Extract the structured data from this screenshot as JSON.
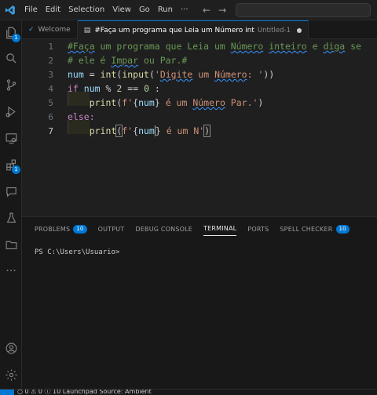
{
  "menu": [
    "File",
    "Edit",
    "Selection",
    "View",
    "Go",
    "Run",
    "···"
  ],
  "tabs": [
    {
      "label": "Welcome"
    },
    {
      "label": "#Faça um programa que Leia um Número int",
      "desc": "Untitled-1"
    }
  ],
  "editor": {
    "line_numbers": [
      "1",
      "2",
      "3",
      "4",
      "5",
      "6",
      "7"
    ],
    "lines": [
      "#Faça um programa que Leia um Número inteiro e diga se",
      "# ele é Impar ou Par.#",
      "num = int(input('Digite um Número: '))",
      "if num % 2 == 0 :",
      "    print(f'{num} é um Número Par.')",
      "else:",
      "    print(f'{num} é um N')"
    ]
  },
  "activity_badges": {
    "explorer": "1",
    "extensions": "1"
  },
  "panel": {
    "tabs": [
      {
        "label": "PROBLEMS",
        "badge": "10"
      },
      {
        "label": "OUTPUT"
      },
      {
        "label": "DEBUG CONSOLE"
      },
      {
        "label": "TERMINAL"
      },
      {
        "label": "PORTS"
      },
      {
        "label": "SPELL CHECKER",
        "badge": "10"
      }
    ],
    "terminal_prompt": "PS C:\\Users\\Usuario>"
  },
  "status": {
    "text": "○ 0 ⚠ 0  ⓘ 10    Launchpad  Source: Ambient"
  },
  "colors": {
    "accent": "#0078d4",
    "comment": "#6a9955",
    "keyword": "#c586c0",
    "function": "#dcdcaa",
    "string": "#ce9178",
    "variable": "#9cdcfe",
    "number": "#b5cea8"
  }
}
